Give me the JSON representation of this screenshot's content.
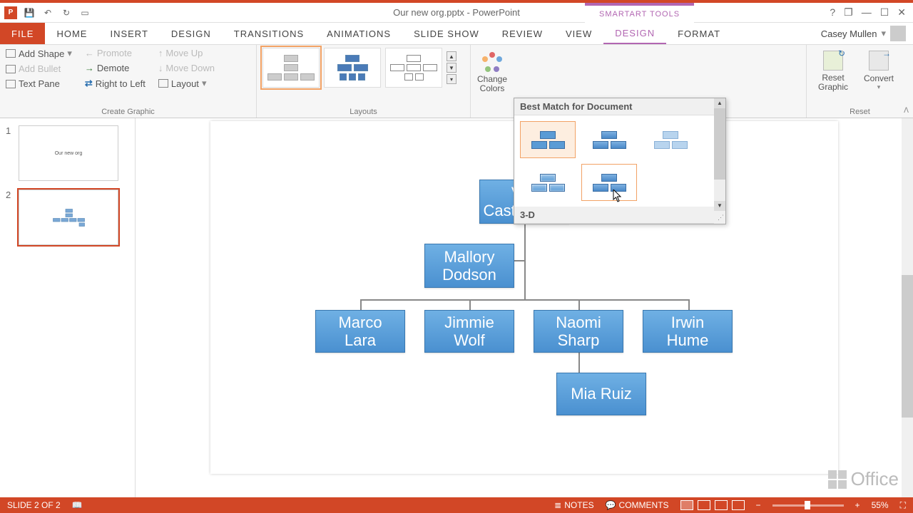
{
  "title_bar": {
    "doc_title": "Our new org.pptx - PowerPoint",
    "tools_label": "SMARTART TOOLS"
  },
  "window_controls": {
    "help": "?",
    "restore": "❐",
    "min": "—",
    "max": "☐",
    "close": "✕"
  },
  "tabs": {
    "file": "FILE",
    "home": "HOME",
    "insert": "INSERT",
    "design_main": "DESIGN",
    "transitions": "TRANSITIONS",
    "animations": "ANIMATIONS",
    "slideshow": "SLIDE SHOW",
    "review": "REVIEW",
    "view": "VIEW",
    "sa_design": "DESIGN",
    "sa_format": "FORMAT"
  },
  "user": {
    "name": "Casey Mullen"
  },
  "ribbon": {
    "create_graphic": {
      "label": "Create Graphic",
      "add_shape": "Add Shape",
      "add_bullet": "Add Bullet",
      "text_pane": "Text Pane",
      "promote": "Promote",
      "demote": "Demote",
      "rtl": "Right to Left",
      "move_up": "Move Up",
      "move_down": "Move Down",
      "layout": "Layout"
    },
    "layouts_label": "Layouts",
    "change_colors": "Change\nColors",
    "reset": {
      "label": "Reset",
      "reset_graphic": "Reset\nGraphic",
      "convert": "Convert"
    }
  },
  "gallery": {
    "best_match": "Best Match for Document",
    "three_d": "3-D"
  },
  "slides": {
    "s1_num": "1",
    "s1_title": "Our new org",
    "s2_num": "2"
  },
  "org": {
    "n1": "Vict\nCastellanos",
    "n2": "Mallory\nDodson",
    "n3": "Marco Lara",
    "n4": "Jimmie\nWolf",
    "n5": "Naomi\nSharp",
    "n6": "Irwin\nHume",
    "n7": "Mia Ruiz"
  },
  "status": {
    "slide": "SLIDE 2 OF 2",
    "notes": "NOTES",
    "comments": "COMMENTS",
    "zoom": "55%"
  },
  "office_brand": "Office"
}
